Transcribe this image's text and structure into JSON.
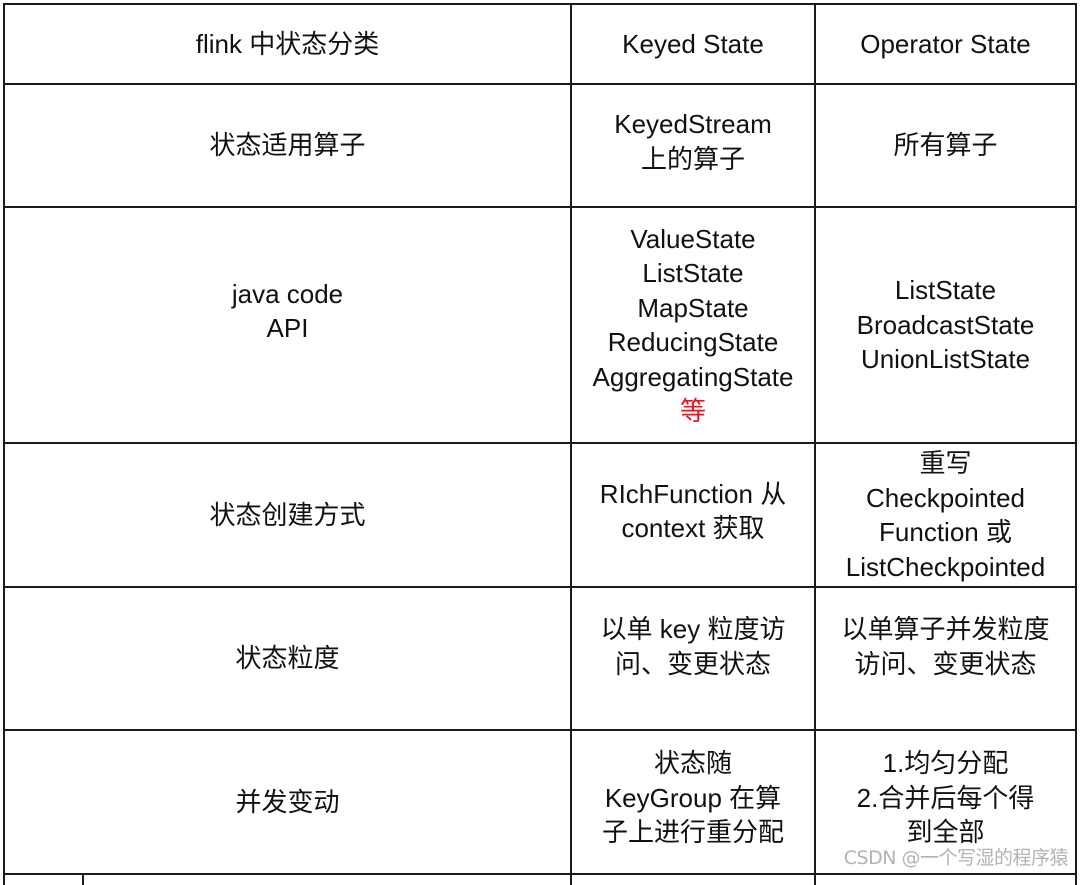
{
  "table": {
    "header": [
      "flink 中状态分类",
      "Keyed State",
      "Operator State"
    ],
    "rows": [
      {
        "label": [
          "状态适用算子"
        ],
        "keyed": [
          "KeyedStream",
          "上的算子"
        ],
        "operator": [
          "所有算子"
        ]
      },
      {
        "label": [
          "java code",
          "API"
        ],
        "keyed": [
          "ValueState",
          "ListState",
          "MapState",
          "ReducingState",
          "AggregatingState"
        ],
        "keyed_highlight": "等",
        "operator": [
          "ListState",
          "BroadcastState",
          "UnionListState"
        ]
      },
      {
        "label": [
          "状态创建方式"
        ],
        "keyed": [
          "RIchFunction 从",
          "context 获取"
        ],
        "operator": [
          "重写",
          "Checkpointed",
          "Function 或",
          "ListCheckpointed"
        ]
      },
      {
        "label": [
          "状态粒度"
        ],
        "keyed": [
          "以单 key 粒度访",
          "问、变更状态"
        ],
        "operator": [
          "以单算子并发粒度",
          "访问、变更状态"
        ]
      },
      {
        "label": [
          "并发变动"
        ],
        "keyed": [
          "状态随",
          "KeyGroup 在算",
          "子上进行重分配"
        ],
        "operator": [
          "1.均匀分配",
          "2.合并后每个得",
          "到全部"
        ]
      }
    ]
  },
  "colors": {
    "border": "#1a1a1a",
    "text": "#111111",
    "highlight": "#f0121e",
    "watermark": "#b3b3b3"
  },
  "watermark": "CSDN @一个写湿的程序猿"
}
